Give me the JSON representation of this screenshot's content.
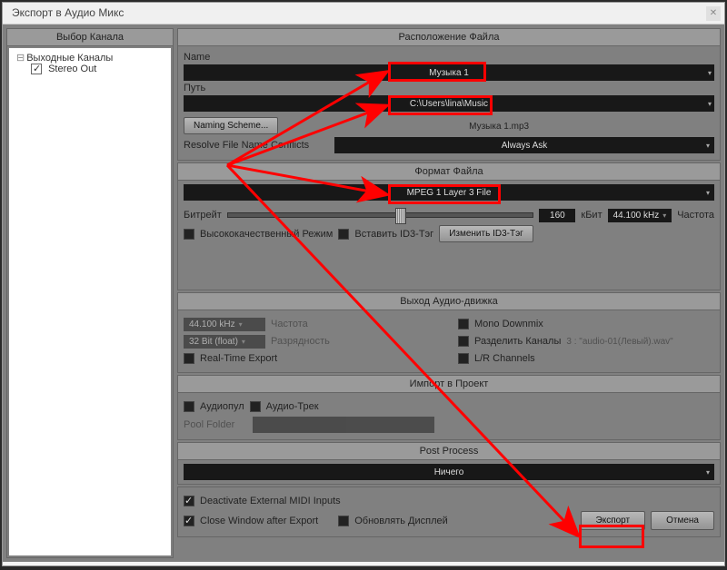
{
  "window": {
    "title": "Экспорт в Аудио Микс"
  },
  "sidebar": {
    "header": "Выбор Канала",
    "tree": {
      "root": "Выходные Каналы",
      "child": "Stereo Out"
    }
  },
  "fileLocation": {
    "header": "Расположение Файла",
    "nameLabel": "Name",
    "nameValue": "Музыка 1",
    "pathLabel": "Путь",
    "pathValue": "C:\\Users\\lina\\Music",
    "namingScheme": "Naming Scheme...",
    "resultFile": "Музыка 1.mp3",
    "conflictsLabel": "Resolve File Name Conflicts",
    "conflictsValue": "Always Ask"
  },
  "fileFormat": {
    "header": "Формат Файла",
    "formatValue": "MPEG 1 Layer 3 File",
    "bitrateLabel": "Битрейт",
    "bitrateValue": "160",
    "kbitLabel": "кБит",
    "sampleRate": "44.100 kHz",
    "freqLabel": "Частота",
    "hqMode": "Высококачественный Режим",
    "insertId3": "Вставить ID3-Тэг",
    "editId3": "Изменить ID3-Тэг"
  },
  "audioEngine": {
    "header": "Выход Аудио-движка",
    "sampleRate": "44.100 kHz",
    "freqLabel": "Частота",
    "bitDepth": "32 Bit (float)",
    "bitLabel": "Разрядность",
    "realtime": "Real-Time Export",
    "monoDown": "Mono Downmix",
    "splitChannels": "Разделить Каналы",
    "splitExample": "3 : \"audio-01(Левый).wav\"",
    "lrChannels": "L/R Channels"
  },
  "import": {
    "header": "Импорт в Проект",
    "audioPool": "Аудиопул",
    "audioTrack": "Аудио-Трек",
    "poolFolder": "Pool Folder"
  },
  "postProcess": {
    "header": "Post Process",
    "value": "Ничего"
  },
  "footer": {
    "deactivateMidi": "Deactivate External MIDI Inputs",
    "closeAfter": "Close Window after Export",
    "updateDisplay": "Обновлять Дисплей",
    "export": "Экспорт",
    "cancel": "Отмена"
  }
}
